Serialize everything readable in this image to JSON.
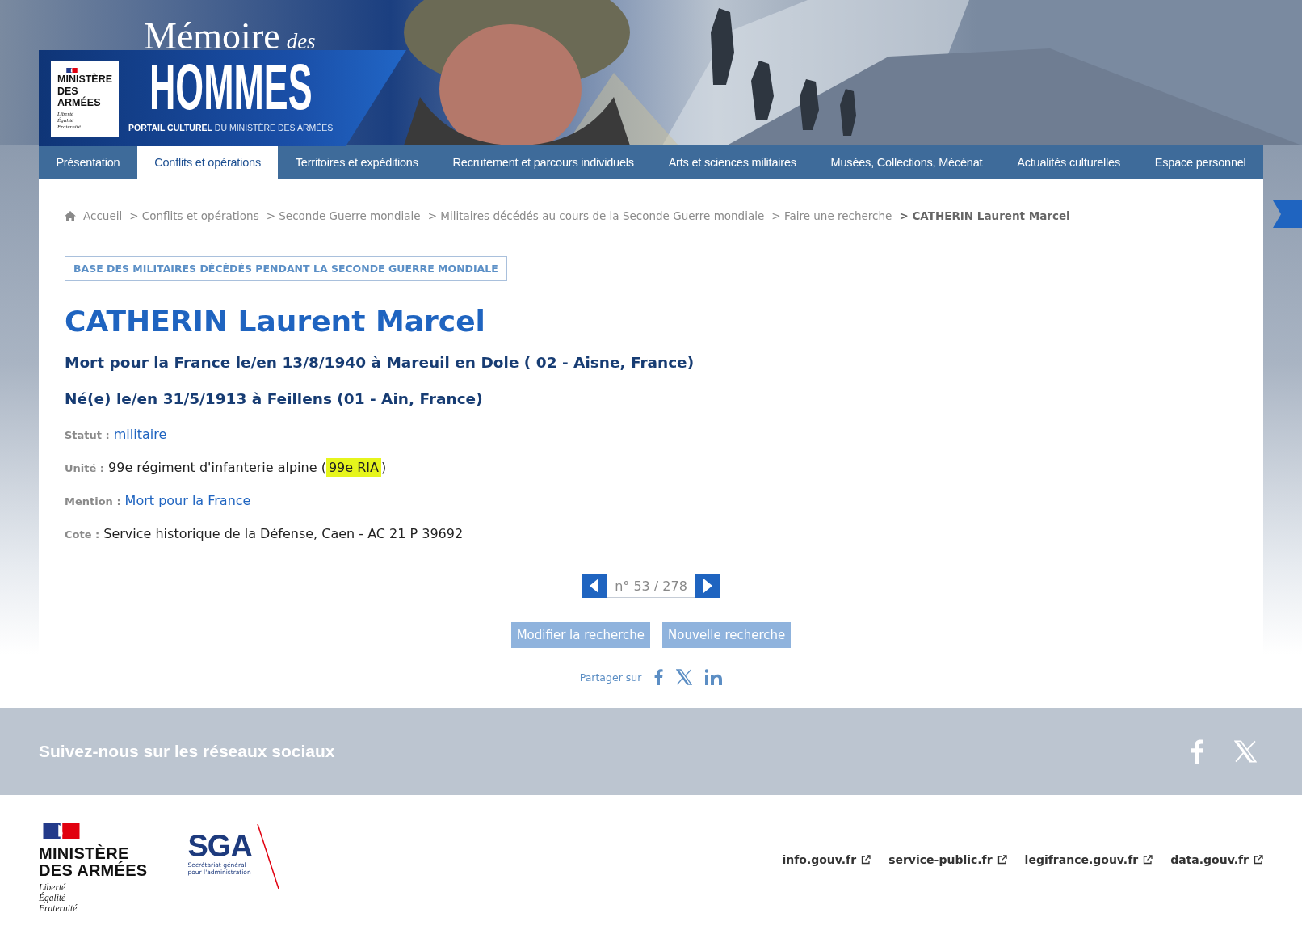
{
  "header": {
    "title": "Mémoire",
    "title_small": "des",
    "title_big": "HOMMES",
    "tagline": "**PORTAIL CULTUREL** DU MINISTÈRE DES ARMÉES",
    "logo": {
      "lines": [
        "MINISTÈRE",
        "DES ARMÉES"
      ],
      "motto": [
        "Liberté",
        "Égalité",
        "Fraternité"
      ]
    }
  },
  "nav": [
    {
      "label": "Présentation",
      "selected": false
    },
    {
      "label": "Conflits et opérations",
      "selected": true
    },
    {
      "label": "Territoires et expéditions",
      "selected": false
    },
    {
      "label": "Recrutement et parcours individuels",
      "selected": false
    },
    {
      "label": "Arts et sciences militaires",
      "selected": false
    },
    {
      "label": "Musées, Collections, Mécénat",
      "selected": false
    },
    {
      "label": "Actualités culturelles",
      "selected": false
    },
    {
      "label": "Espace personnel",
      "selected": false
    }
  ],
  "breadcrumb": [
    {
      "label": "Accueil",
      "current": false
    },
    {
      "label": "> Conflits et opérations",
      "current": false
    },
    {
      "label": "> Seconde Guerre mondiale",
      "current": false
    },
    {
      "label": "> Militaires décédés au cours de la Seconde Guerre mondiale",
      "current": false
    },
    {
      "label": "> Faire une recherche",
      "current": false
    },
    {
      "label": "> CATHERIN Laurent Marcel",
      "current": true
    }
  ],
  "record": {
    "database": "BASE DES MILITAIRES DÉCÉDÉS PENDANT LA SECONDE GUERRE MONDIALE",
    "name": "CATHERIN Laurent Marcel",
    "death": "Mort pour la France le/en 13/8/1940 à Mareuil en Dole ( 02 - Aisne, France)",
    "birth": "Né(e) le/en 31/5/1913 à Feillens (01 - Ain, France)",
    "fields": [
      {
        "label": "Statut :",
        "kind": "link",
        "value": "militaire"
      },
      {
        "label": "Unité :",
        "kind": "text",
        "parts": [
          {
            "text": "99e régiment d'infanterie alpine (",
            "highlighted": false
          },
          {
            "text": "99e RIA",
            "highlighted": true
          },
          {
            "text": ")",
            "highlighted": false
          }
        ]
      },
      {
        "label": "Mention :",
        "kind": "link",
        "value": "Mort pour la France"
      },
      {
        "label": "Cote :",
        "kind": "text",
        "parts": [
          {
            "text": "Service historique de la Défense, Caen - AC 21 P 39692",
            "highlighted": false
          }
        ]
      }
    ]
  },
  "pagination": {
    "counter": "n° 53 / 278"
  },
  "buttons": [
    "Modifier la recherche",
    "Nouvelle recherche"
  ],
  "share": {
    "label": "Partager sur"
  },
  "social": {
    "title": "Suivez-nous sur les réseaux sociaux"
  },
  "footer": {
    "ministry": {
      "lines": [
        "MINISTÈRE",
        "DES ARMÉES"
      ],
      "motto": [
        "Liberté",
        "Égalité",
        "Fraternité"
      ]
    },
    "sga": {
      "acronym": "SGA",
      "subtitle": [
        "Secrétariat général",
        "pour l'administration"
      ]
    },
    "links": [
      "info.gouv.fr",
      "service-public.fr",
      "legifrance.gouv.fr",
      "data.gouv.fr"
    ]
  }
}
